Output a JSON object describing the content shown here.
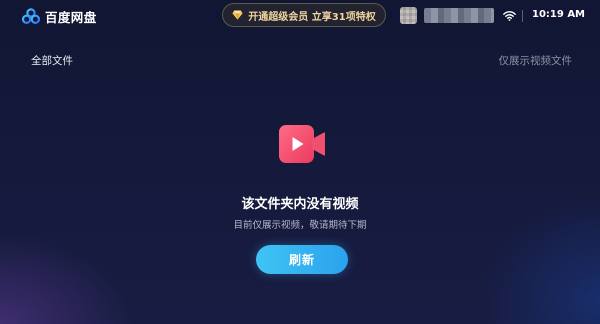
{
  "header": {
    "app_name": "百度网盘",
    "vip_promo": "开通超级会员 立享31项特权",
    "clock": "10:19 AM",
    "icons": {
      "logo": "cloud-logo-icon",
      "vip": "diamond-icon",
      "wifi": "wifi-icon"
    }
  },
  "subheader": {
    "folder_path": "全部文件",
    "filter_note": "仅展示视频文件"
  },
  "empty_state": {
    "icon": "video-camera-icon",
    "title": "该文件夹内没有视频",
    "subtitle": "目前仅展示视频，敬请期待下期",
    "refresh_label": "刷新"
  },
  "colors": {
    "background": "#151a3c",
    "accent_blue": "#2ba2ee",
    "video_icon": "#f04b6a",
    "vip_text": "#f1d6a0"
  }
}
